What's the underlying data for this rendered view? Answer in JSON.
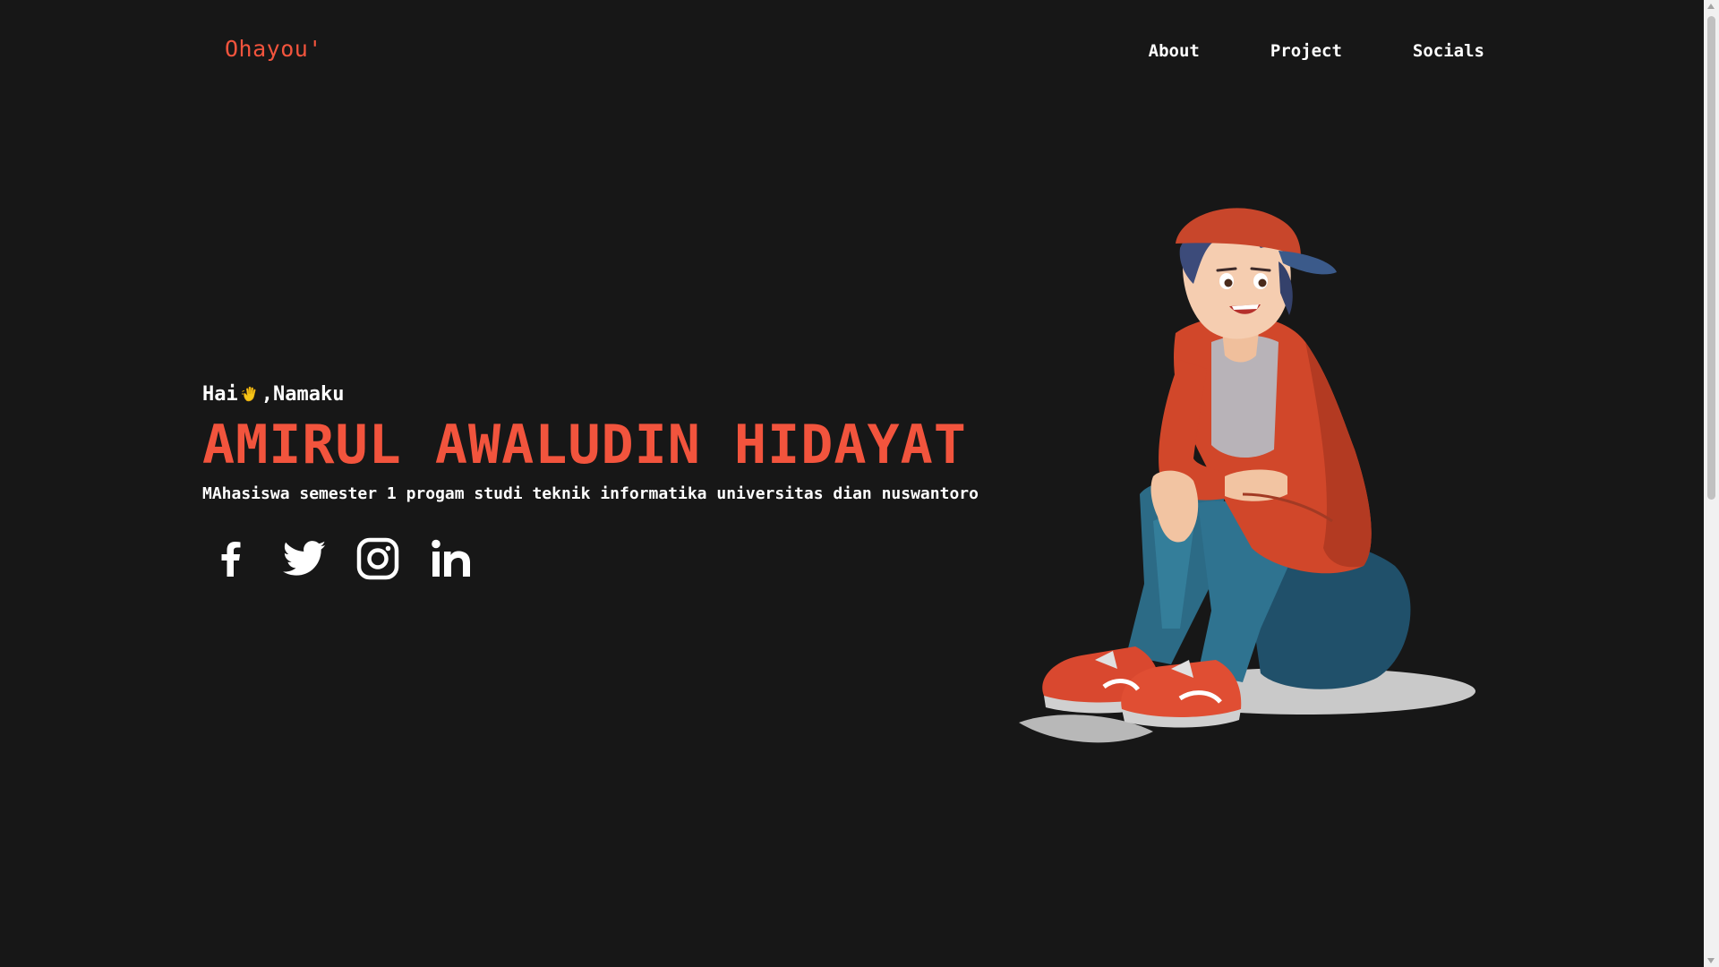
{
  "brand": {
    "logo_text": "Ohayou'"
  },
  "nav": {
    "items": [
      {
        "label": "About"
      },
      {
        "label": "Project"
      },
      {
        "label": "Socials"
      }
    ]
  },
  "hero": {
    "greeting_before": "Hai",
    "greeting_after": ",Namaku",
    "wave_icon": "waving-hand-icon",
    "name": "AMIRUL AWALUDIN HIDAYAT",
    "subtitle": "MAhasiswa semester 1 progam studi teknik informatika universitas dian nuswantoro"
  },
  "socials": [
    {
      "icon": "facebook-icon"
    },
    {
      "icon": "twitter-icon"
    },
    {
      "icon": "instagram-icon"
    },
    {
      "icon": "linkedin-icon"
    }
  ],
  "illustration": {
    "subject": "cartoon boy in red cap and hoodie sitting"
  },
  "colors": {
    "background": "#171717",
    "accent": "#f2543d",
    "text": "#ffffff"
  }
}
